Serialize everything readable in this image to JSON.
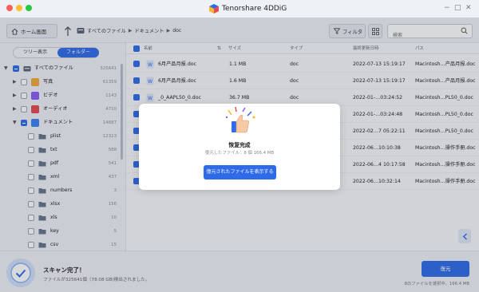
{
  "app": {
    "title": "Tenorshare 4DDiG",
    "window_controls": [
      "−",
      "□",
      "✕"
    ]
  },
  "toolbar": {
    "home_label": "ホーム画面",
    "breadcrumb": [
      "すべてのファイル",
      "ドキュメント",
      "doc"
    ],
    "filter_label": "フィルタ",
    "search_placeholder": "検索"
  },
  "sidebar": {
    "tab_tree": "ツリー表示",
    "tab_folder": "フォルダー",
    "items": [
      {
        "label": "すべてのファイル",
        "count": "325641",
        "expanded": true
      },
      {
        "label": "写真",
        "count": "61359"
      },
      {
        "label": "ビデオ",
        "count": "1143"
      },
      {
        "label": "オーディオ",
        "count": "4710"
      },
      {
        "label": "ドキュメント",
        "count": "14687",
        "expanded": true
      },
      {
        "label": "plist",
        "count": "12323"
      },
      {
        "label": "txt",
        "count": "588"
      },
      {
        "label": "pdf",
        "count": "541"
      },
      {
        "label": "xml",
        "count": "437"
      },
      {
        "label": "numbers",
        "count": "3"
      },
      {
        "label": "xlsx",
        "count": "156"
      },
      {
        "label": "xls",
        "count": "10"
      },
      {
        "label": "key",
        "count": "5"
      },
      {
        "label": "csv",
        "count": "15"
      }
    ]
  },
  "table": {
    "columns": [
      "名前",
      "サイズ",
      "タイプ",
      "最終更新日時",
      "パス"
    ],
    "rows": [
      {
        "name": "6月产品月报.doc",
        "size": "1.1 MB",
        "type": "doc",
        "date": "2022-07-13 15:19:17",
        "path": "Macintosh…产品月报.doc"
      },
      {
        "name": "6月产品月报.doc",
        "size": "1.6 MB",
        "type": "doc",
        "date": "2022-07-13 15:19:17",
        "path": "Macintosh…产品月报.doc"
      },
      {
        "name": "_0_AAPL50_0.doc",
        "size": "36.7 MB",
        "type": "doc",
        "date": "2022-01-…03:24:52",
        "path": "Macintosh…PL50_0.doc"
      },
      {
        "name": "",
        "size": "",
        "type": "",
        "date": "2022-01-…03:24:48",
        "path": "Macintosh…PL50_0.doc"
      },
      {
        "name": "",
        "size": "",
        "type": "",
        "date": "2022-02…7 05:22:11",
        "path": "Macintosh…PL50_0.doc"
      },
      {
        "name": "",
        "size": "",
        "type": "",
        "date": "2022-06…10:10:38",
        "path": "Macintosh…操作手册.doc"
      },
      {
        "name": "",
        "size": "",
        "type": "",
        "date": "2022-06…4 10:17:58",
        "path": "Macintosh…操作手册.doc"
      },
      {
        "name": "",
        "size": "",
        "type": "",
        "date": "2022-06…10:32:14",
        "path": "Macintosh…操作手册.doc"
      }
    ]
  },
  "bottom": {
    "scan_title": "スキャン完了！",
    "scan_sub": "ファイルが325641個（78.08 GB)検出されました。",
    "recover_label": "復元",
    "selection_info": "8のファイルを選択中、166.4 MB"
  },
  "dialog": {
    "title": "恢复完成",
    "subtitle": "復元したファイル：8 個 166.4 MB",
    "button_label": "復元されたファイルを表示する"
  },
  "colors": {
    "accent": "#2f6be8",
    "background": "#eef1f6"
  }
}
